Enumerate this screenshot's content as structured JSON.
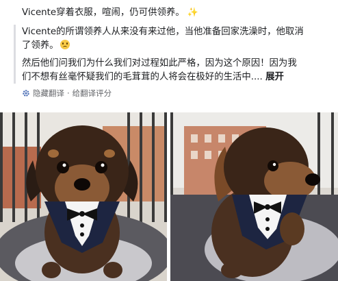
{
  "post": {
    "line1": "Vicente穿着衣服，喧闹，仍可供领养。",
    "line1_emoji": "✨",
    "line2": "Vicente的所谓领养人从来没有来过他，当他准备回家洗澡时，他取消",
    "line3": "了领养。",
    "line4": "然后他们问我们为什么我们对过程如此严格，因为这个原因！因为我",
    "line5": "们不想有丝毫怀疑我们的毛茸茸的人将会在极好的生活中....",
    "more_label": "展开"
  },
  "translation": {
    "hide_label": "隐藏翻译",
    "separator": "·",
    "rate_label": "给翻译评分"
  },
  "icons": {
    "sparkle": "sparkles-icon",
    "sad": "sad-face-icon",
    "gear": "gear-icon"
  },
  "colors": {
    "text": "#1c1e21",
    "secondary": "#65676b",
    "accent": "#4267b2"
  }
}
